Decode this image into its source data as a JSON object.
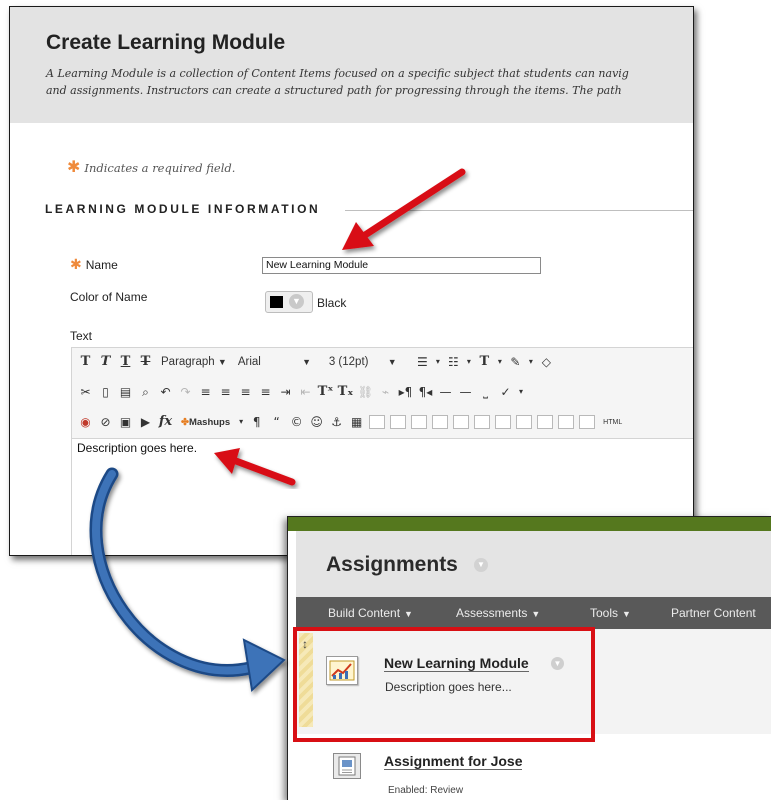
{
  "create_module": {
    "title": "Create Learning Module",
    "description_line1": "A Learning Module is a collection of Content Items focused on a specific subject that students can navig",
    "description_line2": "and assignments. Instructors can create a structured path for progressing through the items. The path",
    "required_note": "Indicates a required field.",
    "section_heading": "LEARNING MODULE INFORMATION",
    "name_label": "Name",
    "name_value": "New Learning Module",
    "color_label": "Color of Name",
    "color_value": "Black",
    "text_label": "Text",
    "editor_text": "Description goes here."
  },
  "toolbar": {
    "row1": {
      "bold": "T",
      "italic": "T",
      "underline": "T",
      "strike": "T",
      "format_select": "Paragraph",
      "font_select": "Arial",
      "size_select": "3 (12pt)"
    },
    "row3": {
      "function": "fx",
      "mashups": "Mashups",
      "pilcrow": "¶",
      "quote": "“",
      "copyright": "©",
      "html": "HTML"
    }
  },
  "assignments": {
    "title": "Assignments",
    "menu": [
      {
        "label": "Build Content"
      },
      {
        "label": "Assessments"
      },
      {
        "label": "Tools"
      },
      {
        "label": "Partner Content"
      }
    ],
    "item1": {
      "title": "New Learning Module",
      "description": "Description goes here..."
    },
    "item2": {
      "title": "Assignment for Jose",
      "meta": "Enabled:  Review"
    }
  },
  "colors": {
    "annotation_red": "#d80f14",
    "annotation_arrow_blue": "#2d5d9a",
    "required_star": "#ef8a3b",
    "menu_bar": "#595959",
    "green_band": "#55781e"
  }
}
